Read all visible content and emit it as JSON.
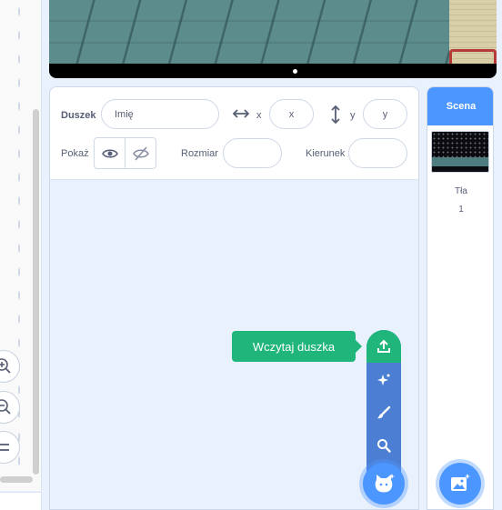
{
  "sprite_info": {
    "sprite_label": "Duszek",
    "name_placeholder": "Imię",
    "x_label": "x",
    "x_placeholder": "x",
    "y_label": "y",
    "y_placeholder": "y",
    "show_label": "Pokaż",
    "size_label": "Rozmiar",
    "size_value": "",
    "direction_label": "Kierunek",
    "direction_value": ""
  },
  "sprite_menu": {
    "tooltip": "Wczytaj duszka",
    "items": [
      "upload-icon",
      "surprise-icon",
      "paint-icon",
      "search-icon"
    ],
    "fab_icon": "choose-sprite-icon"
  },
  "stage_selector": {
    "header": "Scena",
    "backdrops_label": "Tła",
    "backdrops_count": "1",
    "fab_icon": "choose-backdrop-icon"
  },
  "zoom_controls": [
    "zoom-in-icon",
    "zoom-out-icon",
    "zoom-reset-icon"
  ],
  "colors": {
    "accent": "#4c97ff",
    "menu": "#4c7fd4",
    "upload_green": "#1fb57b",
    "text": "#575e75",
    "panel_bg": "#e9f1fc"
  }
}
